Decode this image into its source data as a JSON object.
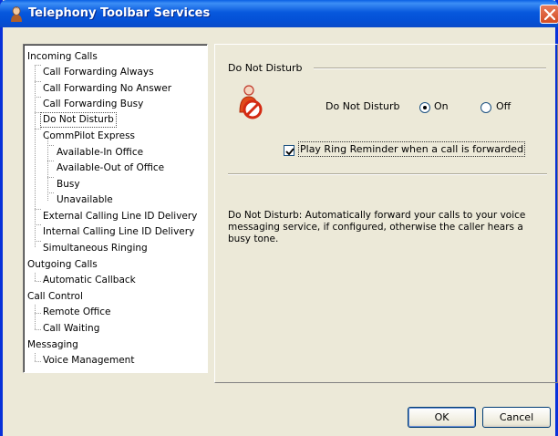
{
  "window": {
    "title": "Telephony Toolbar Services",
    "title_icon": "user-silhouette-icon",
    "close_icon": "close-icon"
  },
  "tree": {
    "items": [
      {
        "label": "Incoming Calls",
        "level": 0
      },
      {
        "label": "Call Forwarding Always",
        "level": 1
      },
      {
        "label": "Call Forwarding No Answer",
        "level": 1
      },
      {
        "label": "Call Forwarding Busy",
        "level": 1
      },
      {
        "label": "Do Not Disturb",
        "level": 1,
        "selected": true
      },
      {
        "label": "CommPilot Express",
        "level": 1
      },
      {
        "label": "Available-In Office",
        "level": 2
      },
      {
        "label": "Available-Out of Office",
        "level": 2
      },
      {
        "label": "Busy",
        "level": 2
      },
      {
        "label": "Unavailable",
        "level": 2
      },
      {
        "label": "External Calling Line ID Delivery",
        "level": 1
      },
      {
        "label": "Internal Calling Line ID Delivery",
        "level": 1
      },
      {
        "label": "Simultaneous Ringing",
        "level": 1
      },
      {
        "label": "Outgoing Calls",
        "level": 0
      },
      {
        "label": "Automatic Callback",
        "level": 1
      },
      {
        "label": "Call Control",
        "level": 0
      },
      {
        "label": "Remote Office",
        "level": 1
      },
      {
        "label": "Call Waiting",
        "level": 1
      },
      {
        "label": "Messaging",
        "level": 0
      },
      {
        "label": "Voice Management",
        "level": 1
      }
    ]
  },
  "panel": {
    "section_title": "Do Not Disturb",
    "icon": "do-not-disturb-icon",
    "setting_label": "Do Not Disturb",
    "options": [
      {
        "label": "On",
        "selected": true
      },
      {
        "label": "Off",
        "selected": false
      }
    ],
    "ring_reminder": {
      "label": "Play Ring Reminder when a call is forwarded",
      "checked": true
    },
    "description": "Do Not Disturb: Automatically forward your calls to your voice messaging service, if configured, otherwise the caller hears a busy tone."
  },
  "buttons": {
    "ok": "OK",
    "cancel": "Cancel"
  },
  "colors": {
    "titlebar": "#0758dd",
    "dialog_bg": "#ece9d8",
    "close_button": "#d34c24"
  }
}
